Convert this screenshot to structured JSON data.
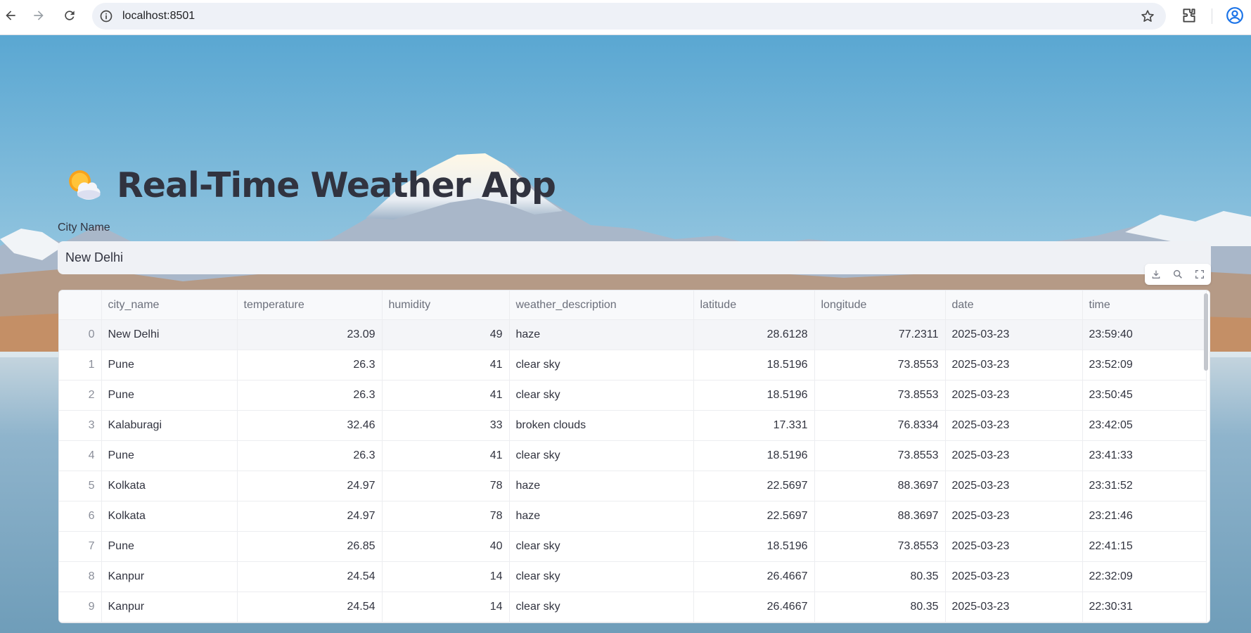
{
  "browser": {
    "url": "localhost:8501",
    "icons": [
      "back-arrow-icon",
      "forward-arrow-icon",
      "reload-icon",
      "info-icon",
      "star-icon",
      "extensions-icon",
      "profile-icon"
    ]
  },
  "app": {
    "title": "Real-Time Weather App",
    "title_icon": "sun-behind-cloud-icon",
    "city_label": "City Name",
    "city_value": "New Delhi"
  },
  "table": {
    "toolbar_icons": [
      "download-icon",
      "search-icon",
      "fullscreen-icon"
    ],
    "columns": [
      "",
      "city_name",
      "temperature",
      "humidity",
      "weather_description",
      "latitude",
      "longitude",
      "date",
      "time"
    ],
    "rows": [
      [
        "0",
        "New Delhi",
        "23.09",
        "49",
        "haze",
        "28.6128",
        "77.2311",
        "2025-03-23",
        "23:59:40"
      ],
      [
        "1",
        "Pune",
        "26.3",
        "41",
        "clear sky",
        "18.5196",
        "73.8553",
        "2025-03-23",
        "23:52:09"
      ],
      [
        "2",
        "Pune",
        "26.3",
        "41",
        "clear sky",
        "18.5196",
        "73.8553",
        "2025-03-23",
        "23:50:45"
      ],
      [
        "3",
        "Kalaburagi",
        "32.46",
        "33",
        "broken clouds",
        "17.331",
        "76.8334",
        "2025-03-23",
        "23:42:05"
      ],
      [
        "4",
        "Pune",
        "26.3",
        "41",
        "clear sky",
        "18.5196",
        "73.8553",
        "2025-03-23",
        "23:41:33"
      ],
      [
        "5",
        "Kolkata",
        "24.97",
        "78",
        "haze",
        "22.5697",
        "88.3697",
        "2025-03-23",
        "23:31:52"
      ],
      [
        "6",
        "Kolkata",
        "24.97",
        "78",
        "haze",
        "22.5697",
        "88.3697",
        "2025-03-23",
        "23:21:46"
      ],
      [
        "7",
        "Pune",
        "26.85",
        "40",
        "clear sky",
        "18.5196",
        "73.8553",
        "2025-03-23",
        "22:41:15"
      ],
      [
        "8",
        "Kanpur",
        "24.54",
        "14",
        "clear sky",
        "26.4667",
        "80.35",
        "2025-03-23",
        "22:32:09"
      ],
      [
        "9",
        "Kanpur",
        "24.54",
        "14",
        "clear sky",
        "26.4667",
        "80.35",
        "2025-03-23",
        "22:30:31"
      ]
    ]
  },
  "colors": {
    "text": "#31333f",
    "header_text": "#6b6f7b",
    "input_bg": "#eff1f5",
    "sky_top": "#5aa7d2",
    "sky_bottom": "#cfe3ea"
  }
}
